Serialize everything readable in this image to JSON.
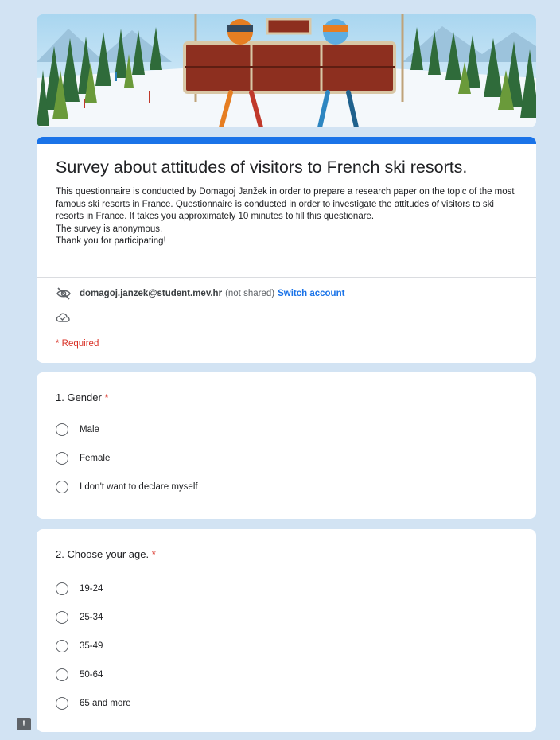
{
  "header": {
    "title": "Survey about attitudes of visitors to French ski resorts.",
    "description": [
      "This questionnaire is conducted by Domagoj Janžek in order to prepare a research paper on the topic of the most famous ski resorts in France. Questionnaire is conducted in order to investigate the attitudes of visitors to ski resorts in France. It takes you approximately 10 minutes to fill this questionare.",
      "The survey is anonymous.",
      "Thank you for participating!"
    ],
    "accent_color": "#1a73e8"
  },
  "account": {
    "email": "domagoj.janzek@student.mev.hr",
    "not_shared": "(not shared)",
    "switch_label": "Switch account",
    "icon": "eye-off-icon",
    "cloud_icon": "cloud-check-icon"
  },
  "required_note": "* Required",
  "questions": [
    {
      "title": "1. Gender",
      "required_mark": "*",
      "options": [
        "Male",
        "Female",
        "I don't want to declare myself"
      ]
    },
    {
      "title": "2. Choose your age.",
      "required_mark": "*",
      "options": [
        "19-24",
        "25-34",
        "35-49",
        "50-64",
        "65 and more"
      ]
    }
  ],
  "feedback_icon": "report-feedback-icon",
  "colors": {
    "page_background": "#d2e3f3",
    "required": "#d93025",
    "link": "#1a73e8"
  }
}
